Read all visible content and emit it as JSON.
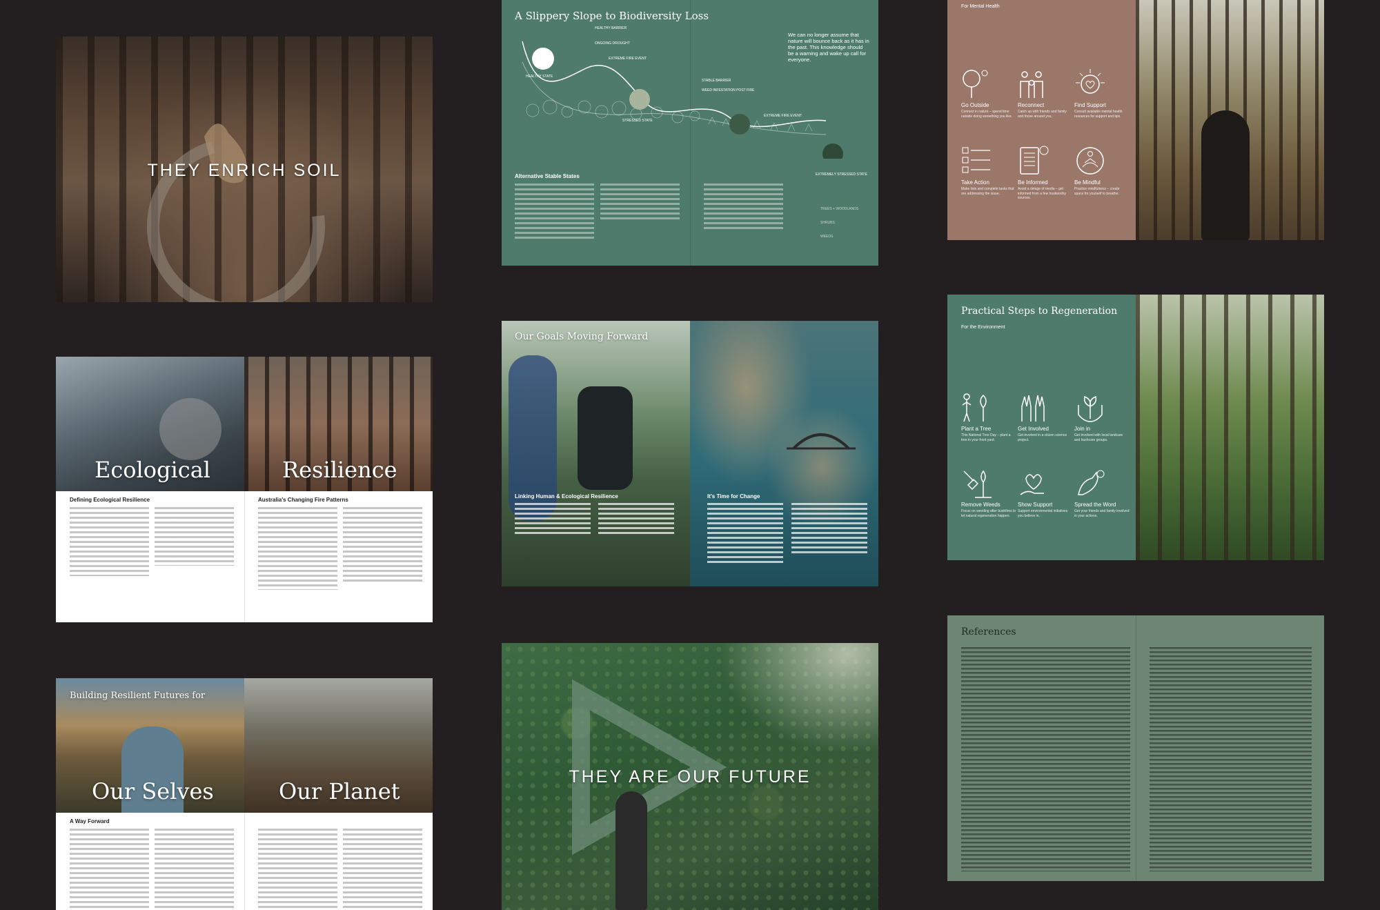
{
  "soil": {
    "title": "THEY ENRICH SOIL"
  },
  "biodiversity": {
    "title": "A Slippery Slope to Biodiversity Loss",
    "quote": "We can no longer assume that nature will bounce back as it has in the past. This knowledge should be a warning and wake up call for everyone.",
    "states": [
      "HEALTHY BARRIER",
      "ONGOING DROUGHT",
      "EXTREME FIRE EVENT",
      "HEALTHY STATE",
      "STRESSED STATE",
      "STABLE BARRIER",
      "WEED INFESTATION POST FIRE",
      "EXTREME FIRE EVENT",
      "EXTREMELY STRESSED STATE"
    ],
    "subheading": "Alternative Stable States",
    "legend": [
      "TREES + WOODLANDS",
      "SHRUBS",
      "WEEDS"
    ]
  },
  "mental": {
    "kicker": "For Mental Health",
    "items": [
      {
        "label": "Go Outside",
        "sub": "Connect in nature – spend time outside doing something you like."
      },
      {
        "label": "Reconnect",
        "sub": "Catch up with friends and family and those around you."
      },
      {
        "label": "Find Support",
        "sub": "Consult available mental health resources for support and tips."
      },
      {
        "label": "Take Action",
        "sub": "Make lists and complete tasks that are addressing the issue."
      },
      {
        "label": "Be Informed",
        "sub": "Avoid a deluge of media – get informed from a few trustworthy sources."
      },
      {
        "label": "Be Mindful",
        "sub": "Practice mindfulness – create space for yourself to breathe."
      }
    ]
  },
  "resilience": {
    "left_title": "Ecological",
    "right_title": "Resilience",
    "left_heading": "Defining Ecological Resilience",
    "right_heading": "Australia's Changing Fire Patterns"
  },
  "goals": {
    "title": "Our Goals Moving Forward",
    "left_heading": "Linking Human & Ecological Resilience",
    "right_heading": "It's Time for Change"
  },
  "regeneration": {
    "title": "Practical Steps to Regeneration",
    "kicker": "For the Environment",
    "items": [
      {
        "label": "Plant a Tree",
        "sub": "This National Tree Day – plant a tree in your front yard."
      },
      {
        "label": "Get Involved",
        "sub": "Get involved in a citizen science project."
      },
      {
        "label": "Join in",
        "sub": "Get involved with local landcare and bushcare groups."
      },
      {
        "label": "Remove Weeds",
        "sub": "Focus on weeding after bushfires to let natural regeneration happen."
      },
      {
        "label": "Show Support",
        "sub": "Support environmental initiatives you believe in."
      },
      {
        "label": "Spread the Word",
        "sub": "Get your friends and family involved in your actions."
      }
    ]
  },
  "futures": {
    "kicker": "Building Resilient Futures for",
    "left_title": "Our Selves",
    "right_title": "Our Planet",
    "heading": "A Way Forward"
  },
  "future": {
    "title": "THEY ARE OUR FUTURE"
  },
  "references": {
    "title": "References"
  },
  "colors": {
    "background": "#231f20",
    "green": "#4e7b6b",
    "mauve": "#9b7769",
    "sage": "#6d8673"
  }
}
